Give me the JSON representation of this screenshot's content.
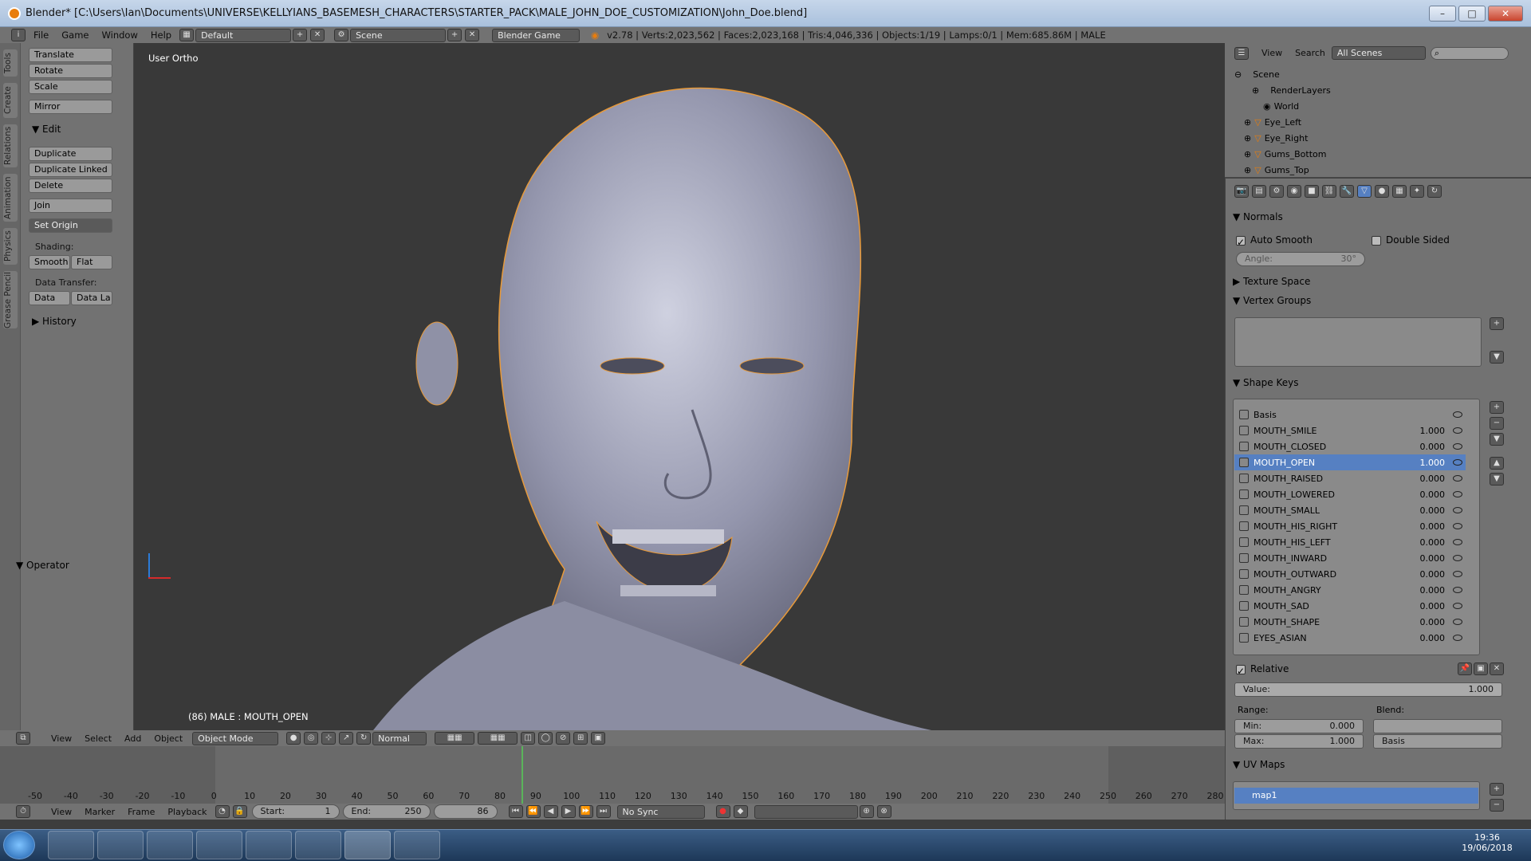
{
  "window": {
    "title": "Blender* [C:\\Users\\Ian\\Documents\\UNIVERSE\\KELLYIANS_BASEMESH_CHARACTERS\\STARTER_PACK\\MALE_JOHN_DOE_CUSTOMIZATION\\John_Doe.blend]"
  },
  "menubar": {
    "items": [
      "File",
      "Game",
      "Window",
      "Help"
    ],
    "layout": "Default",
    "scene": "Scene",
    "engine": "Blender Game",
    "stats": "v2.78 | Verts:2,023,562 | Faces:2,023,168 | Tris:4,046,336 | Objects:1/19 | Lamps:0/1 | Mem:685.86M | MALE"
  },
  "toolshelf": {
    "tabs": [
      "Tools",
      "Create",
      "Relations",
      "Animation",
      "Physics",
      "Grease Pencil"
    ],
    "transform": [
      "Translate",
      "Rotate",
      "Scale"
    ],
    "mirror": "Mirror",
    "edit_header": "Edit",
    "edit": [
      "Duplicate",
      "Duplicate Linked",
      "Delete"
    ],
    "join": "Join",
    "set_origin": "Set Origin",
    "shading_label": "Shading:",
    "smooth": "Smooth",
    "flat": "Flat",
    "data_transfer_label": "Data Transfer:",
    "data": "Data",
    "data_la": "Data La",
    "history": "History",
    "operator": "Operator"
  },
  "viewport": {
    "view_label": "User Ortho",
    "object_label": "(86) MALE : MOUTH_OPEN"
  },
  "viewport_header": {
    "items": [
      "View",
      "Select",
      "Add",
      "Object"
    ],
    "mode": "Object Mode",
    "pivot": "Normal"
  },
  "timeline": {
    "ticks": [
      -50,
      -40,
      -30,
      -20,
      -10,
      0,
      10,
      20,
      30,
      40,
      50,
      60,
      70,
      80,
      90,
      100,
      110,
      120,
      130,
      140,
      150,
      160,
      170,
      180,
      190,
      200,
      210,
      220,
      230,
      240,
      250,
      260,
      270,
      280
    ],
    "current_frame": 86,
    "footer": [
      "View",
      "Marker",
      "Frame",
      "Playback"
    ],
    "start_label": "Start:",
    "start": "1",
    "end_label": "End:",
    "end": "250",
    "frame": "86",
    "sync": "No Sync"
  },
  "outliner": {
    "view": "View",
    "search": "Search",
    "scenes": "All Scenes",
    "items": [
      "Scene",
      "RenderLayers",
      "World",
      "Eye_Left",
      "Eye_Right",
      "Gums_Bottom",
      "Gums_Top"
    ]
  },
  "properties": {
    "normals": "Normals",
    "auto_smooth": "Auto Smooth",
    "double_sided": "Double Sided",
    "angle_label": "Angle:",
    "angle": "30°",
    "texture_space": "Texture Space",
    "vertex_groups": "Vertex Groups",
    "shape_keys": "Shape Keys",
    "keys": [
      {
        "name": "Basis",
        "value": ""
      },
      {
        "name": "MOUTH_SMILE",
        "value": "1.000"
      },
      {
        "name": "MOUTH_CLOSED",
        "value": "0.000"
      },
      {
        "name": "MOUTH_OPEN",
        "value": "1.000"
      },
      {
        "name": "MOUTH_RAISED",
        "value": "0.000"
      },
      {
        "name": "MOUTH_LOWERED",
        "value": "0.000"
      },
      {
        "name": "MOUTH_SMALL",
        "value": "0.000"
      },
      {
        "name": "MOUTH_HIS_RIGHT",
        "value": "0.000"
      },
      {
        "name": "MOUTH_HIS_LEFT",
        "value": "0.000"
      },
      {
        "name": "MOUTH_INWARD",
        "value": "0.000"
      },
      {
        "name": "MOUTH_OUTWARD",
        "value": "0.000"
      },
      {
        "name": "MOUTH_ANGRY",
        "value": "0.000"
      },
      {
        "name": "MOUTH_SAD",
        "value": "0.000"
      },
      {
        "name": "MOUTH_SHAPE",
        "value": "0.000"
      },
      {
        "name": "EYES_ASIAN",
        "value": "0.000"
      }
    ],
    "relative": "Relative",
    "value_label": "Value:",
    "value": "1.000",
    "range_label": "Range:",
    "blend_label": "Blend:",
    "min_label": "Min:",
    "min": "0.000",
    "max_label": "Max:",
    "max": "1.000",
    "blend": "Basis",
    "uv_maps": "UV Maps",
    "uv_map": "map1"
  },
  "taskbar": {
    "time": "19:36",
    "date": "19/06/2018"
  }
}
